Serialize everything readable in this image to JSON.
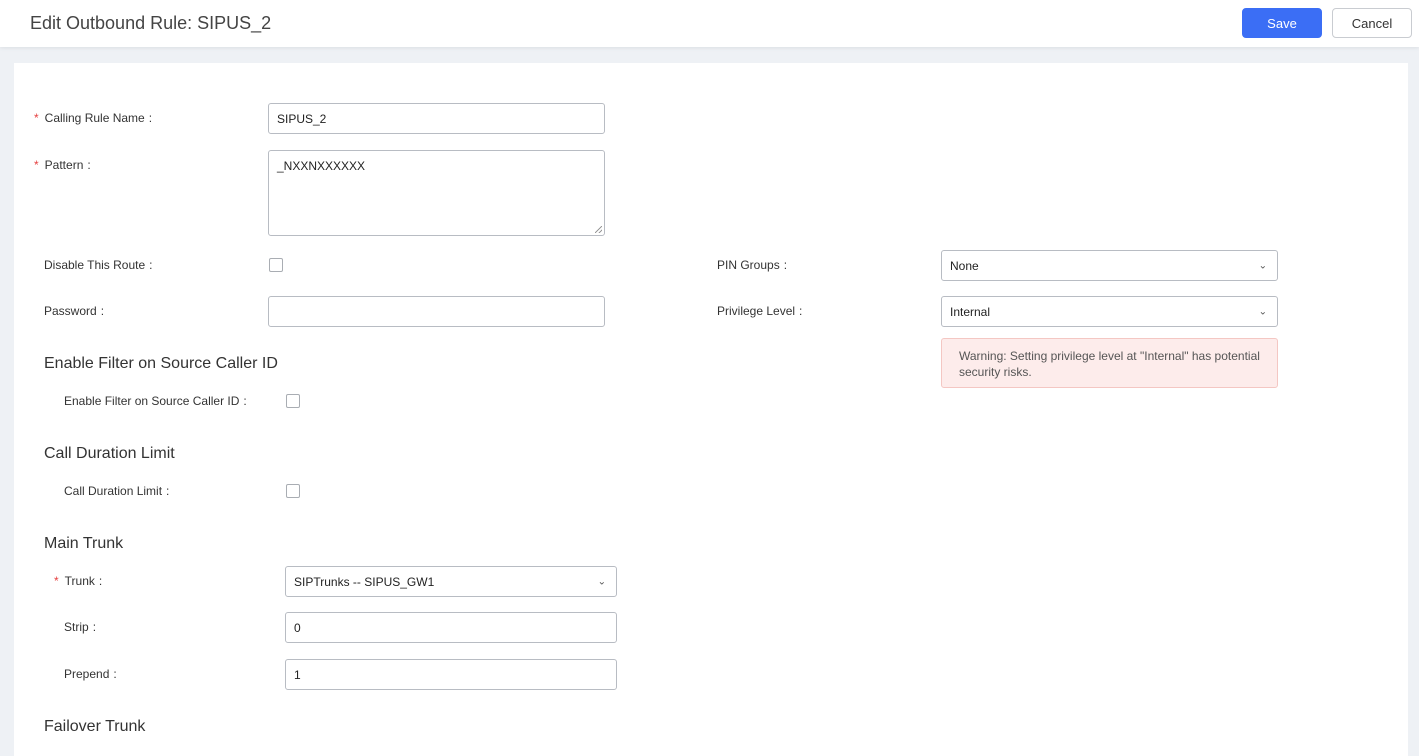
{
  "header": {
    "title": "Edit Outbound Rule: SIPUS_2",
    "save_label": "Save",
    "cancel_label": "Cancel"
  },
  "form": {
    "calling_rule_name": {
      "label": "Calling Rule Name",
      "value": "SIPUS_2",
      "required": true
    },
    "pattern": {
      "label": "Pattern",
      "value": "_NXXNXXXXXX",
      "required": true
    },
    "disable_route": {
      "label": "Disable This Route",
      "checked": false
    },
    "pin_groups": {
      "label": "PIN Groups",
      "value": "None"
    },
    "password": {
      "label": "Password",
      "value": ""
    },
    "privilege_level": {
      "label": "Privilege Level",
      "value": "Internal"
    },
    "warning": "Warning: Setting privilege level at \"Internal\" has potential security risks."
  },
  "sections": {
    "source_filter": {
      "title": "Enable Filter on Source Caller ID",
      "checkbox_label": "Enable Filter on Source Caller ID",
      "checked": false
    },
    "call_duration": {
      "title": "Call Duration Limit",
      "checkbox_label": "Call Duration Limit",
      "checked": false
    },
    "main_trunk": {
      "title": "Main Trunk",
      "trunk": {
        "label": "Trunk",
        "value": "SIPTrunks -- SIPUS_GW1",
        "required": true
      },
      "strip": {
        "label": "Strip",
        "value": "0"
      },
      "prepend": {
        "label": "Prepend",
        "value": "1"
      }
    },
    "failover_trunk": {
      "title": "Failover Trunk"
    }
  },
  "colors": {
    "primary": "#3b6ef5",
    "required": "#e54040",
    "warning_bg": "#fdeceb"
  },
  "icons": {
    "select": "chevron-down-icon"
  }
}
